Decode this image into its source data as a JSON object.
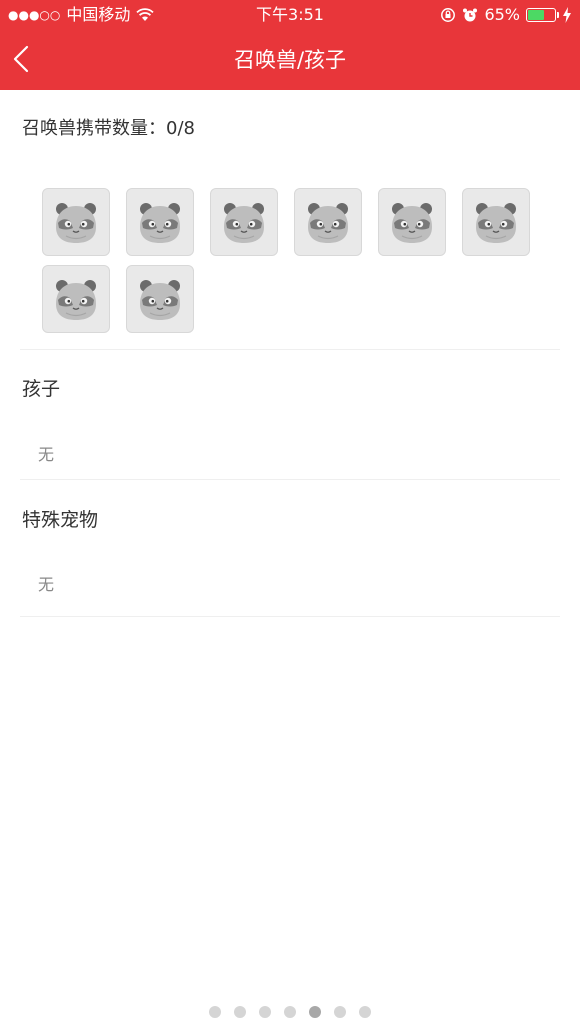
{
  "status": {
    "carrier": "中国移动",
    "signal_dots": "●●●○○",
    "time": "下午3:51",
    "battery": "65%",
    "battery_level": 0.65
  },
  "nav": {
    "title": "召唤兽/孩子"
  },
  "summary": {
    "label": "召唤兽携带数量：",
    "value": "0/8"
  },
  "slots": [
    {
      "icon": "panda-placeholder-icon"
    },
    {
      "icon": "panda-placeholder-icon"
    },
    {
      "icon": "panda-placeholder-icon"
    },
    {
      "icon": "panda-placeholder-icon"
    },
    {
      "icon": "panda-placeholder-icon"
    },
    {
      "icon": "panda-placeholder-icon"
    },
    {
      "icon": "panda-placeholder-icon"
    },
    {
      "icon": "panda-placeholder-icon"
    }
  ],
  "sections": [
    {
      "title": "孩子",
      "empty_text": "无"
    },
    {
      "title": "特殊宠物",
      "empty_text": "无"
    }
  ],
  "pager": {
    "count": 7,
    "active_index": 4
  },
  "colors": {
    "header_bg": "#e8363a",
    "battery_fill": "#4cd964"
  }
}
